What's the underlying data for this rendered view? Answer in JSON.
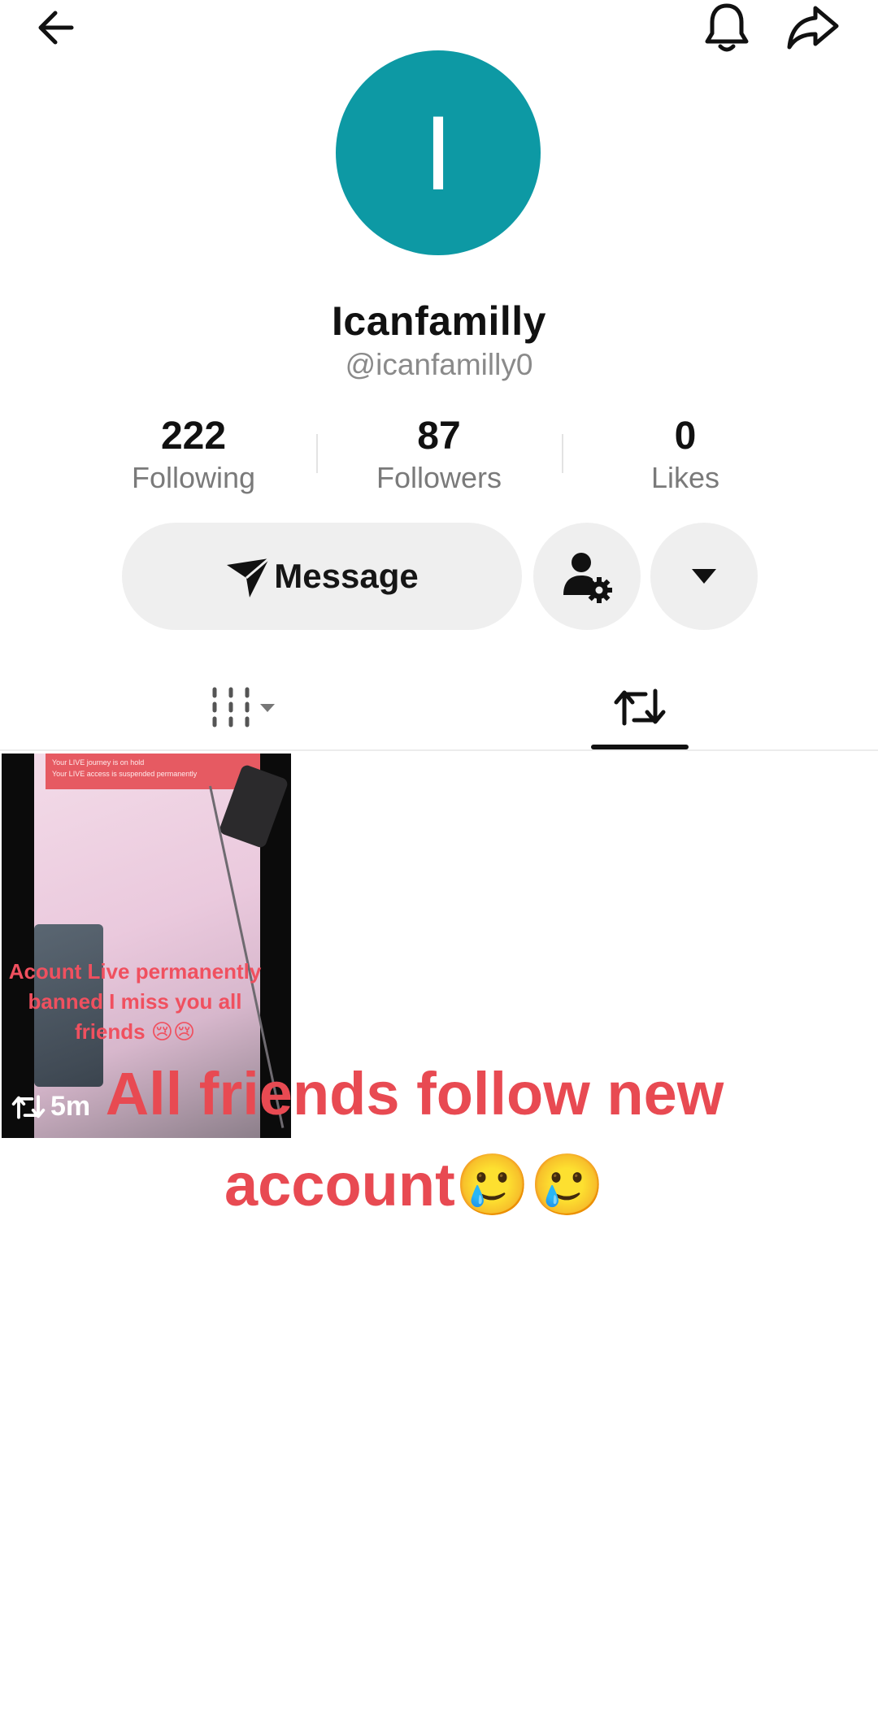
{
  "header": {
    "back_icon": "arrow-left-icon",
    "bell_icon": "bell-icon",
    "share_icon": "share-arrow-icon"
  },
  "profile": {
    "avatar_letter": "I",
    "avatar_color": "#0d99a4",
    "display_name": "Icanfamilly",
    "username": "@icanfamilly0"
  },
  "stats": [
    {
      "value": "222",
      "label": "Following"
    },
    {
      "value": "87",
      "label": "Followers"
    },
    {
      "value": "0",
      "label": "Likes"
    }
  ],
  "actions": {
    "message_label": "Message",
    "message_icon": "paper-plane-icon",
    "friend_settings_icon": "person-gear-icon",
    "dropdown_icon": "caret-down-icon"
  },
  "tabs": [
    {
      "icon": "grid-icon",
      "has_dropdown": true,
      "active": false
    },
    {
      "icon": "repost-icon",
      "active": true
    }
  ],
  "videos": [
    {
      "banner_title": "Your LIVE journey is on hold",
      "banner_text": "Your LIVE access is suspended permanently",
      "caption": "Acount Live permanently banned I miss you all friends 😢😢",
      "badge_icon": "repost-icon",
      "badge_text": "5m"
    }
  ],
  "overlay": {
    "text": "All friends follow new account🥲🥲",
    "color": "#e84a52"
  }
}
